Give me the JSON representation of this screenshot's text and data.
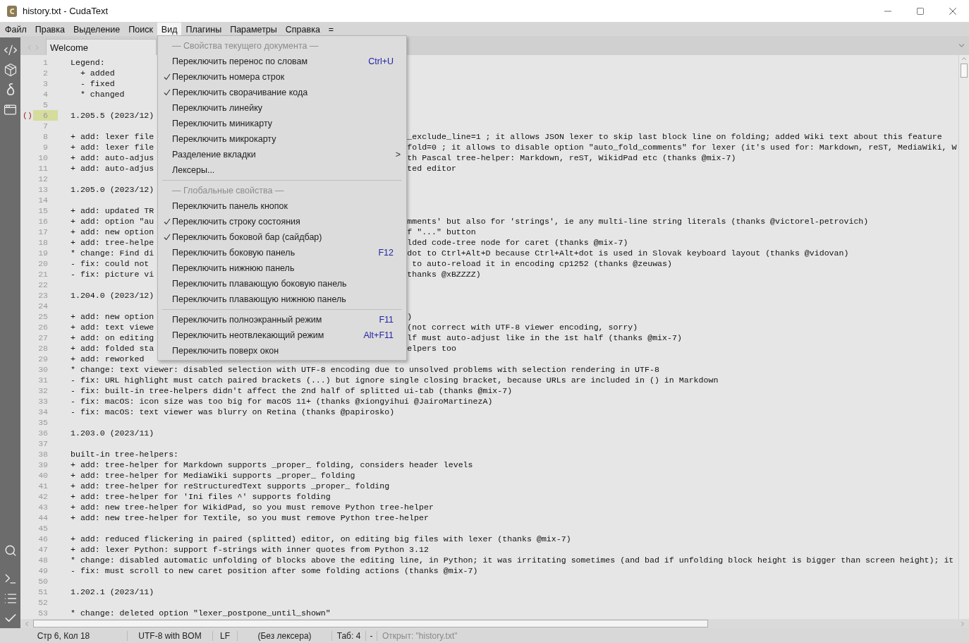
{
  "window": {
    "title": "history.txt - CudaText"
  },
  "menu_bar": [
    {
      "label": "Файл",
      "selected": false
    },
    {
      "label": "Правка",
      "selected": false
    },
    {
      "label": "Выделение",
      "selected": false
    },
    {
      "label": "Поиск",
      "selected": false
    },
    {
      "label": "Вид",
      "selected": true
    },
    {
      "label": "Плагины",
      "selected": false
    },
    {
      "label": "Параметры",
      "selected": false
    },
    {
      "label": "Справка",
      "selected": false
    },
    {
      "label": "=",
      "selected": false
    }
  ],
  "view_menu": [
    {
      "kind": "header",
      "label": "— Свойства текущего документа —"
    },
    {
      "kind": "item",
      "label": "Переключить перенос по словам",
      "checked": false,
      "shortcut": "Ctrl+U"
    },
    {
      "kind": "item",
      "label": "Переключить номера строк",
      "checked": true
    },
    {
      "kind": "item",
      "label": "Переключить сворачивание кода",
      "checked": true
    },
    {
      "kind": "item",
      "label": "Переключить линейку",
      "checked": false
    },
    {
      "kind": "item",
      "label": "Переключить миникарту",
      "checked": false
    },
    {
      "kind": "item",
      "label": "Переключить микрокарту",
      "checked": false
    },
    {
      "kind": "submenu",
      "label": "Разделение вкладки",
      "arrow": ">"
    },
    {
      "kind": "item",
      "label": "Лексеры...",
      "checked": false
    },
    {
      "kind": "separator"
    },
    {
      "kind": "header",
      "label": "— Глобальные свойства —"
    },
    {
      "kind": "item",
      "label": "Переключить панель кнопок",
      "checked": false
    },
    {
      "kind": "item",
      "label": "Переключить строку состояния",
      "checked": true
    },
    {
      "kind": "item",
      "label": "Переключить боковой бар (сайдбар)",
      "checked": true
    },
    {
      "kind": "item",
      "label": "Переключить боковую панель",
      "checked": false,
      "shortcut": "F12"
    },
    {
      "kind": "item",
      "label": "Переключить нижнюю панель",
      "checked": false
    },
    {
      "kind": "item",
      "label": "Переключить плавающую боковую панель",
      "checked": false
    },
    {
      "kind": "item",
      "label": "Переключить плавающую нижнюю панель",
      "checked": false
    },
    {
      "kind": "separator"
    },
    {
      "kind": "item",
      "label": "Переключить полноэкранный режим",
      "checked": false,
      "shortcut": "F11"
    },
    {
      "kind": "item",
      "label": "Переключить неотвлекающий режим",
      "checked": false,
      "shortcut": "Alt+F11"
    },
    {
      "kind": "item",
      "label": "Переключить поверх окон",
      "checked": false
    }
  ],
  "tabs": [
    {
      "label": "Welcome",
      "selected": true
    }
  ],
  "editor": {
    "lines": [
      {
        "number": "1",
        "text": "Legend:",
        "current": false
      },
      {
        "number": "2",
        "text": "  + added",
        "current": false
      },
      {
        "number": "3",
        "text": "  - fixed",
        "current": false
      },
      {
        "number": "4",
        "text": "  * changed",
        "current": false
      },
      {
        "number": "5",
        "current": false
      },
      {
        "number": "6",
        "text": "1.205.5 (2023/12)",
        "marker": "()",
        "current": true
      },
      {
        "number": "7",
        "current": false
      },
      {
        "number": "8",
        "text": "+ add: lexer file",
        "tail": "_exclude_line=1 ; it allows JSON lexer to skip last block line on folding; added Wiki text about this feature",
        "current": false
      },
      {
        "number": "9",
        "text": "+ add: lexer file",
        "tail": "fold=0 ; it allows to disable option \"auto_fold_comments\" for lexer (it's used for: Markdown, reST, MediaWiki, W",
        "current": false
      },
      {
        "number": "10",
        "text": "+ add: auto-adjus",
        "tail": "th Pascal tree-helper: Markdown, reST, WikidPad etc (thanks @mix-7)",
        "current": false
      },
      {
        "number": "11",
        "text": "+ add: auto-adjus",
        "tail": "ted editor",
        "current": false
      },
      {
        "number": "12",
        "current": false
      },
      {
        "number": "13",
        "text": "1.205.0 (2023/12)",
        "current": false
      },
      {
        "number": "14",
        "current": false
      },
      {
        "number": "15",
        "text": "+ add: updated TR",
        "current": false
      },
      {
        "number": "16",
        "text": "+ add: option \"au",
        "tail": "mments' but also for 'strings', ie any multi-line string literals (thanks @victorel-petrovich)",
        "current": false
      },
      {
        "number": "17",
        "text": "+ add: new option",
        "tail": "f \"...\" button",
        "current": false
      },
      {
        "number": "18",
        "text": "+ add: tree-helpe",
        "tail": "lded code-tree node for caret (thanks @mix-7)",
        "current": false
      },
      {
        "number": "19",
        "text": "* change: Find di",
        "tail": "dot to Ctrl+Alt+D because Ctrl+Alt+dot is used in Slovak keyboard layout (thanks @vidovan)",
        "current": false
      },
      {
        "number": "20",
        "text": "- fix: could not",
        "tail": " to auto-reload it in encoding cp1252 (thanks @zeuwas)",
        "current": false
      },
      {
        "number": "21",
        "text": "- fix: picture vi",
        "tail": "thanks @xBZZZZ)",
        "current": false
      },
      {
        "number": "22",
        "current": false
      },
      {
        "number": "23",
        "text": "1.204.0 (2023/12)",
        "current": false
      },
      {
        "number": "24",
        "current": false
      },
      {
        "number": "25",
        "text": "+ add: new option",
        "tail": ")",
        "current": false
      },
      {
        "number": "26",
        "text": "+ add: text viewe",
        "tail": "(not correct with UTF-8 viewer encoding, sorry)",
        "current": false
      },
      {
        "number": "27",
        "text": "+ add: on editing",
        "tail": "lf must auto-adjust like in the 1st half (thanks @mix-7)",
        "current": false
      },
      {
        "number": "28",
        "text": "+ add: folded sta",
        "tail": "elpers too",
        "current": false
      },
      {
        "number": "29",
        "text": "+ add: reworked",
        "current": false
      },
      {
        "number": "30",
        "text": "* change: text viewer: disabled selection with UTF-8 encoding due to unsolved problems with selection rendering in UTF-8",
        "current": false
      },
      {
        "number": "31",
        "text": "- fix: URL highlight must catch paired brackets (...) but ignore single closing bracket, because URLs are included in () in Markdown",
        "current": false
      },
      {
        "number": "32",
        "text": "- fix: built-in tree-helpers didn't affect the 2nd half of splitted ui-tab (thanks @mix-7)",
        "current": false
      },
      {
        "number": "33",
        "text": "- fix: macOS: icon size was too big for macOS 11+ (thanks @xiongyihui @JairoMartinezA)",
        "current": false
      },
      {
        "number": "34",
        "text": "- fix: macOS: text viewer was blurry on Retina (thanks @papirosko)",
        "current": false
      },
      {
        "number": "35",
        "current": false
      },
      {
        "number": "36",
        "text": "1.203.0 (2023/11)",
        "current": false
      },
      {
        "number": "37",
        "current": false
      },
      {
        "number": "38",
        "text": "built-in tree-helpers:",
        "current": false
      },
      {
        "number": "39",
        "text": "+ add: tree-helper for Markdown supports _proper_ folding, considers header levels",
        "current": false
      },
      {
        "number": "40",
        "text": "+ add: tree-helper for MediaWiki supports _proper_ folding",
        "current": false
      },
      {
        "number": "41",
        "text": "+ add: tree-helper for reStructuredText supports _proper_ folding",
        "current": false
      },
      {
        "number": "42",
        "text": "+ add: tree-helper for 'Ini files ^' supports folding",
        "current": false
      },
      {
        "number": "43",
        "text": "+ add: new tree-helper for WikidPad, so you must remove Python tree-helper",
        "current": false
      },
      {
        "number": "44",
        "text": "+ add: new tree-helper for Textile, so you must remove Python tree-helper",
        "current": false
      },
      {
        "number": "45",
        "current": false
      },
      {
        "number": "46",
        "text": "+ add: reduced flickering in paired (splitted) editor, on editing big files with lexer (thanks @mix-7)",
        "current": false
      },
      {
        "number": "47",
        "text": "+ add: lexer Python: support f-strings with inner quotes from Python 3.12",
        "current": false
      },
      {
        "number": "48",
        "text": "* change: disabled automatic unfolding of blocks above the editing line, in Python; it was irritating sometimes (and bad if unfolding block height is bigger than screen height); it",
        "current": false
      },
      {
        "number": "49",
        "text": "- fix: must scroll to new caret position after some folding actions (thanks @mix-7)",
        "current": false
      },
      {
        "number": "50",
        "current": false
      },
      {
        "number": "51",
        "text": "1.202.1 (2023/11)",
        "current": false
      },
      {
        "number": "52",
        "current": false
      },
      {
        "number": "53",
        "text": "* change: deleted option \"lexer_postpone_until_shown\"",
        "current": false
      }
    ]
  },
  "status_bar": [
    {
      "kind": "field",
      "text": "Стр 6, Кол 18"
    },
    {
      "kind": "field",
      "text": "UTF-8 with BOM"
    },
    {
      "kind": "field",
      "text": "LF"
    },
    {
      "kind": "field",
      "text": "(Без лексера)"
    },
    {
      "kind": "field",
      "text": "Таб: 4"
    },
    {
      "kind": "field",
      "text": "-"
    },
    {
      "kind": "message",
      "text": "Открыт: \"history.txt\""
    }
  ]
}
